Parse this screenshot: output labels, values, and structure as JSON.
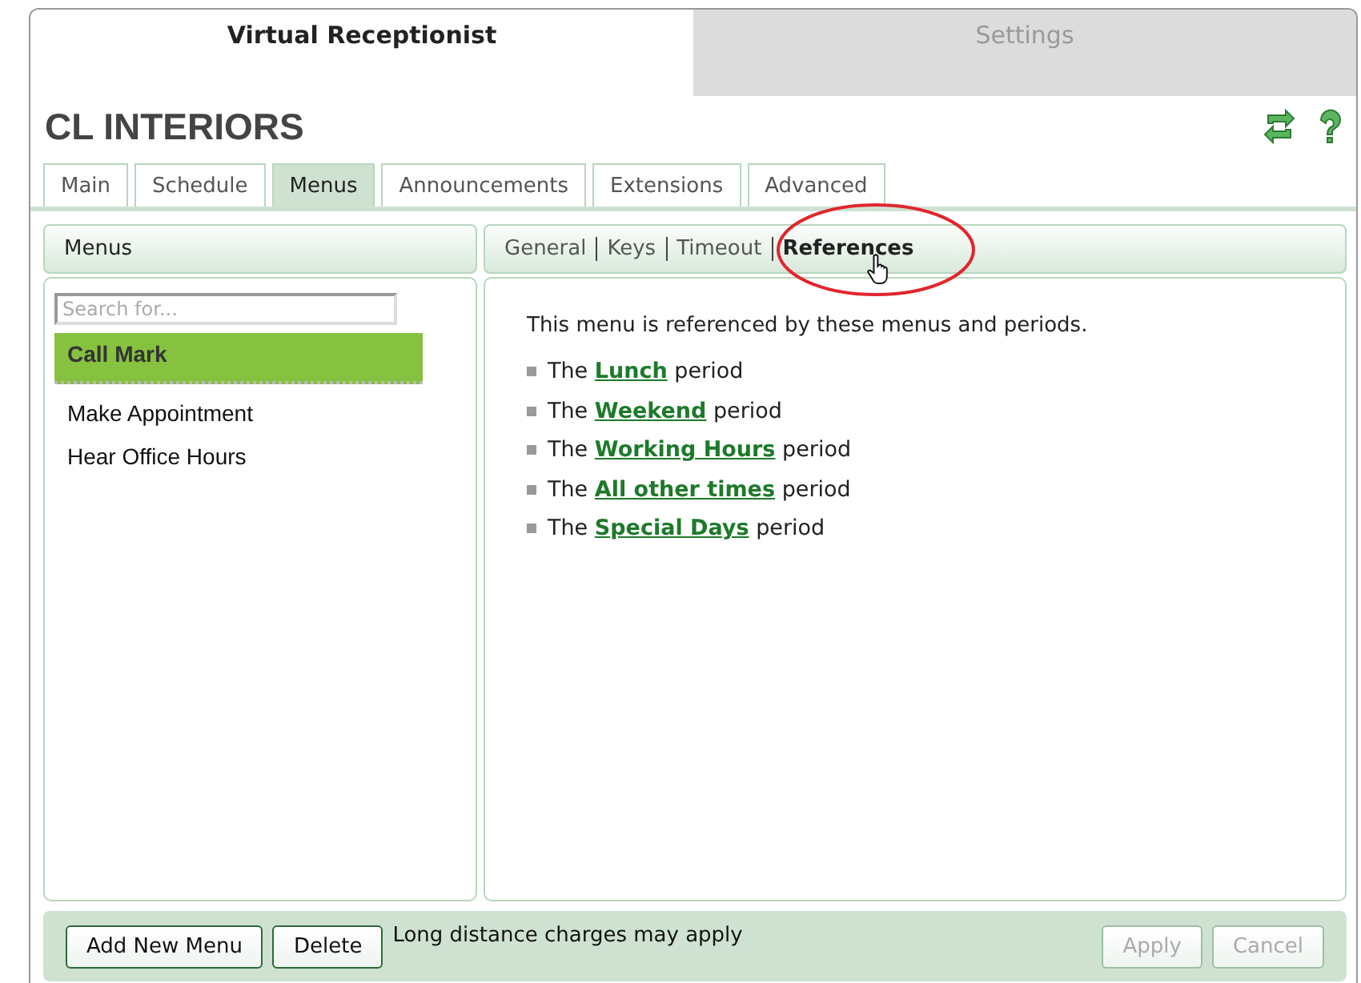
{
  "top_tabs": [
    {
      "label": "Virtual Receptionist",
      "selected": true
    },
    {
      "label": "Settings",
      "selected": false
    }
  ],
  "title": "CL INTERIORS",
  "tabs": [
    {
      "label": "Main",
      "selected": false
    },
    {
      "label": "Schedule",
      "selected": false
    },
    {
      "label": "Menus",
      "selected": true
    },
    {
      "label": "Announcements",
      "selected": false
    },
    {
      "label": "Extensions",
      "selected": false
    },
    {
      "label": "Advanced",
      "selected": false
    }
  ],
  "left_panel": {
    "header": "Menus",
    "search": {
      "placeholder": "Search for..."
    },
    "items": [
      {
        "label": "Call Mark",
        "selected": true
      },
      {
        "label": "Make Appointment",
        "selected": false
      },
      {
        "label": "Hear Office Hours",
        "selected": false
      }
    ]
  },
  "right_panel": {
    "subtabs": [
      {
        "label": "General",
        "selected": false
      },
      {
        "label": "Keys",
        "selected": false
      },
      {
        "label": "Timeout",
        "selected": false
      },
      {
        "label": "References",
        "selected": true
      }
    ],
    "intro": "This menu is referenced by these menus and periods.",
    "references": [
      {
        "prefix": "The",
        "link": "Lunch",
        "suffix": "period"
      },
      {
        "prefix": "The",
        "link": "Weekend",
        "suffix": "period"
      },
      {
        "prefix": "The",
        "link": "Working Hours",
        "suffix": "period"
      },
      {
        "prefix": "The",
        "link": "All other times",
        "suffix": "period"
      },
      {
        "prefix": "The",
        "link": "Special Days",
        "suffix": "period"
      }
    ]
  },
  "footer": {
    "left_buttons": [
      {
        "label": "Add New Menu",
        "disabled": false
      },
      {
        "label": "Delete",
        "disabled": false
      }
    ],
    "note": "Long distance charges may apply",
    "right_buttons": [
      {
        "label": "Apply",
        "disabled": true
      },
      {
        "label": "Cancel",
        "disabled": true
      }
    ]
  }
}
